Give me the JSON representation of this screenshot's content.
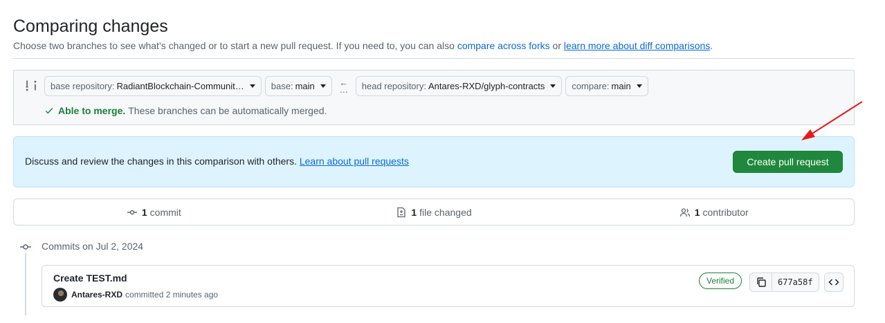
{
  "header": {
    "title": "Comparing changes",
    "subtitle_prefix": "Choose two branches to see what’s changed or to start a new pull request. If you need to, you can also",
    "compare_forks_link": "compare across forks",
    "or_text": "or",
    "learn_diff_link": "learn more about diff comparisons",
    "period": "."
  },
  "range": {
    "base_repo_label": "base repository:",
    "base_repo_value": "RadiantBlockchain-Communit…",
    "base_label": "base:",
    "base_value": "main",
    "head_repo_label": "head repository:",
    "head_repo_value": "Antares-RXD/glyph-contracts",
    "compare_label": "compare:",
    "compare_value": "main",
    "merge_status": "Able to merge.",
    "merge_message": "These branches can be automatically merged."
  },
  "discuss": {
    "text": "Discuss and review the changes in this comparison with others.",
    "link": "Learn about pull requests",
    "button": "Create pull request"
  },
  "summary": {
    "commits_count": "1",
    "commits_label": "commit",
    "files_count": "1",
    "files_label": "file changed",
    "contributors_count": "1",
    "contributors_label": "contributor"
  },
  "commits": {
    "date_heading": "Commits on Jul 2, 2024",
    "items": [
      {
        "title": "Create TEST.md",
        "author": "Antares-RXD",
        "meta": "committed 2 minutes ago",
        "badge": "Verified",
        "sha": "677a58f"
      }
    ]
  },
  "colors": {
    "primary_button": "#1f883d",
    "link": "#0969da",
    "success": "#1a7f37",
    "info_bg": "#ddf4ff",
    "annotation_arrow": "#e8191a"
  },
  "icons": [
    "compare-icon",
    "check-icon",
    "arrow-left-icon",
    "commit-icon",
    "file-diff-icon",
    "people-icon",
    "copy-icon",
    "code-icon",
    "annotation-arrow"
  ]
}
